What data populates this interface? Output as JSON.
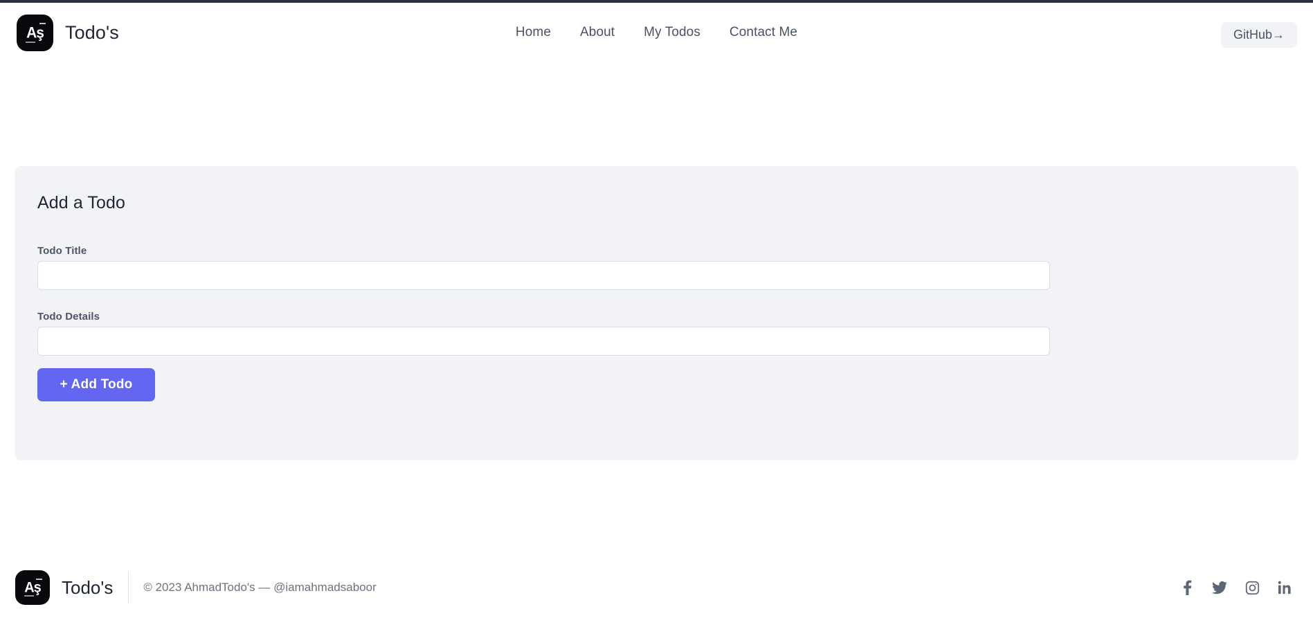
{
  "header": {
    "logo_icon": "as-monogram-logo-icon",
    "brand_name": "Todo's",
    "nav": [
      {
        "label": "Home"
      },
      {
        "label": "About"
      },
      {
        "label": "My Todos"
      },
      {
        "label": "Contact Me"
      }
    ],
    "github_button": {
      "label": "GitHub→",
      "background": "#f1f3f6",
      "text_color": "#4a5365"
    }
  },
  "main": {
    "card": {
      "title": "Add a Todo",
      "background": "#f1f3f6",
      "fields": [
        {
          "label": "Todo Title",
          "value": "",
          "placeholder": ""
        },
        {
          "label": "Todo Details",
          "value": "",
          "placeholder": ""
        }
      ],
      "submit_button": {
        "label": "+ Add Todo",
        "background": "#6366f1",
        "text_color": "#ffffff"
      }
    }
  },
  "footer": {
    "logo_icon": "as-monogram-logo-icon",
    "brand_name": "Todo's",
    "copyright": "© 2023 AhmadTodo's — @iamahmadsaboor",
    "socials": [
      {
        "name": "facebook"
      },
      {
        "name": "twitter"
      },
      {
        "name": "instagram"
      },
      {
        "name": "linkedin"
      }
    ]
  },
  "theme": {
    "top_accent": "#2b303e",
    "page_background": "#ffffff",
    "text_primary": "#1f2633",
    "text_muted": "#6b7280",
    "accent": "#6366f1"
  }
}
